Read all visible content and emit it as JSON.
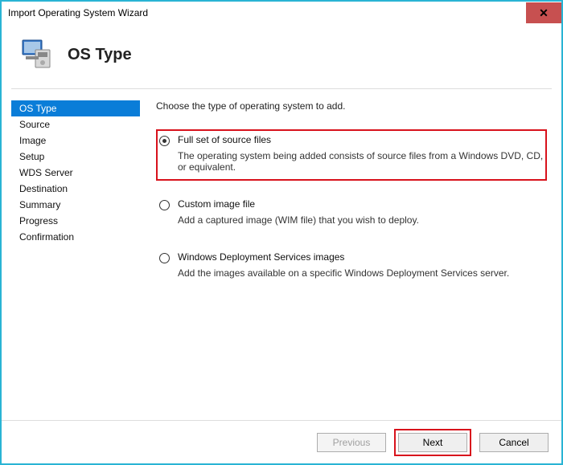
{
  "window": {
    "title": "Import Operating System Wizard"
  },
  "header": {
    "page_title": "OS Type"
  },
  "sidebar": {
    "items": [
      {
        "label": "OS Type"
      },
      {
        "label": "Source"
      },
      {
        "label": "Image"
      },
      {
        "label": "Setup"
      },
      {
        "label": "WDS Server"
      },
      {
        "label": "Destination"
      },
      {
        "label": "Summary"
      },
      {
        "label": "Progress"
      },
      {
        "label": "Confirmation"
      }
    ]
  },
  "content": {
    "instruction": "Choose the type of operating system to add.",
    "options": [
      {
        "label": "Full set of source files",
        "desc": "The operating system being added consists of source files from a Windows DVD, CD, or equivalent."
      },
      {
        "label": "Custom image file",
        "desc": "Add a captured image (WIM file) that you wish to deploy."
      },
      {
        "label": "Windows Deployment Services images",
        "desc": "Add the images available on a specific Windows Deployment Services server."
      }
    ]
  },
  "footer": {
    "previous": "Previous",
    "next": "Next",
    "cancel": "Cancel"
  }
}
